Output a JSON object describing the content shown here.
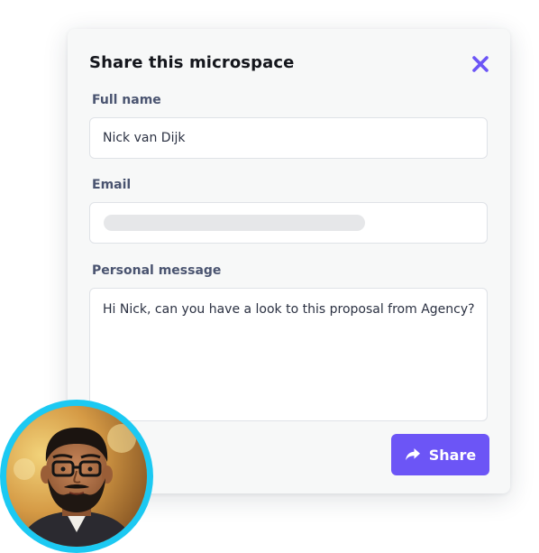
{
  "dialog": {
    "title": "Share this microspace",
    "close_icon": "close-icon",
    "accent_color": "#6c55f6"
  },
  "fields": {
    "full_name": {
      "label": "Full name",
      "value": "Nick van Dijk"
    },
    "email": {
      "label": "Email",
      "value": ""
    },
    "message": {
      "label": "Personal message",
      "value": "Hi Nick, can you have a look to this proposal from Agency?"
    }
  },
  "share_button": {
    "label": "Share",
    "icon": "share-arrow-icon",
    "color": "#6c55f6"
  },
  "avatar": {
    "ring_color": "#1cc9f2"
  }
}
